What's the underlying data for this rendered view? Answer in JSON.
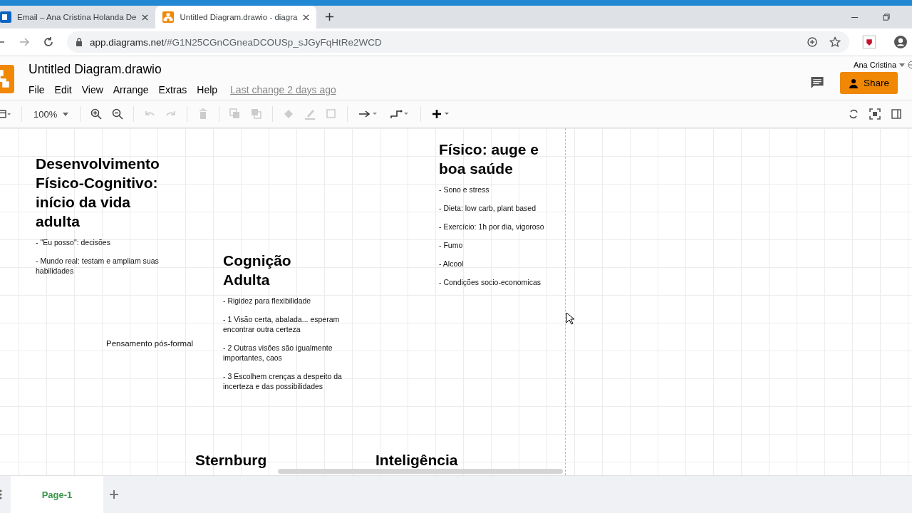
{
  "browser": {
    "tabs": [
      {
        "title": "Email – Ana Cristina Holanda De",
        "selected": false
      },
      {
        "title": "Untitled Diagram.drawio - diagra",
        "selected": true
      }
    ],
    "url_host": "app.diagrams.net",
    "url_rest": "/#G1N25CGnCGneaDCOUSp_sJGyFqHtRe2WCD"
  },
  "app": {
    "title": "Untitled Diagram.drawio",
    "user": "Ana Cristina",
    "menu": [
      "File",
      "Edit",
      "View",
      "Arrange",
      "Extras",
      "Help"
    ],
    "last_change": "Last change 2 days ago",
    "share": "Share",
    "zoom": "100%"
  },
  "canvas": {
    "blocks": [
      {
        "kind": "note",
        "title": "Desenvolvimento Físico-Cognitivo: início da vida adulta",
        "items": [
          "- \"Eu posso\": decisões",
          "- Mundo real: testam e ampliam suas habilidades"
        ]
      },
      {
        "kind": "note",
        "title": "Cognição Adulta",
        "items": [
          "- Rigidez para flexibilidade",
          "- 1  Visão certa, abalada... esperam encontrar outra certeza",
          "- 2 Outras visões são igualmente importantes, caos",
          "- 3 Escolhem crenças a despeito da incerteza e das possibilidades"
        ]
      },
      {
        "kind": "note",
        "title": "Físico: auge e boa saúde",
        "items": [
          "- Sono e stress",
          "- Dieta: low carb, plant based",
          "- Exercício: 1h por dia, vigoroso",
          "- Fumo",
          "- Alcool",
          "- Condições socio-economicas"
        ]
      },
      {
        "kind": "label",
        "text": "Pensamento pós-formal"
      },
      {
        "kind": "heading",
        "text": "Sternburg"
      },
      {
        "kind": "heading",
        "text": "Inteligência"
      }
    ]
  },
  "pages": [
    {
      "label": "Page-1",
      "selected": true
    }
  ]
}
